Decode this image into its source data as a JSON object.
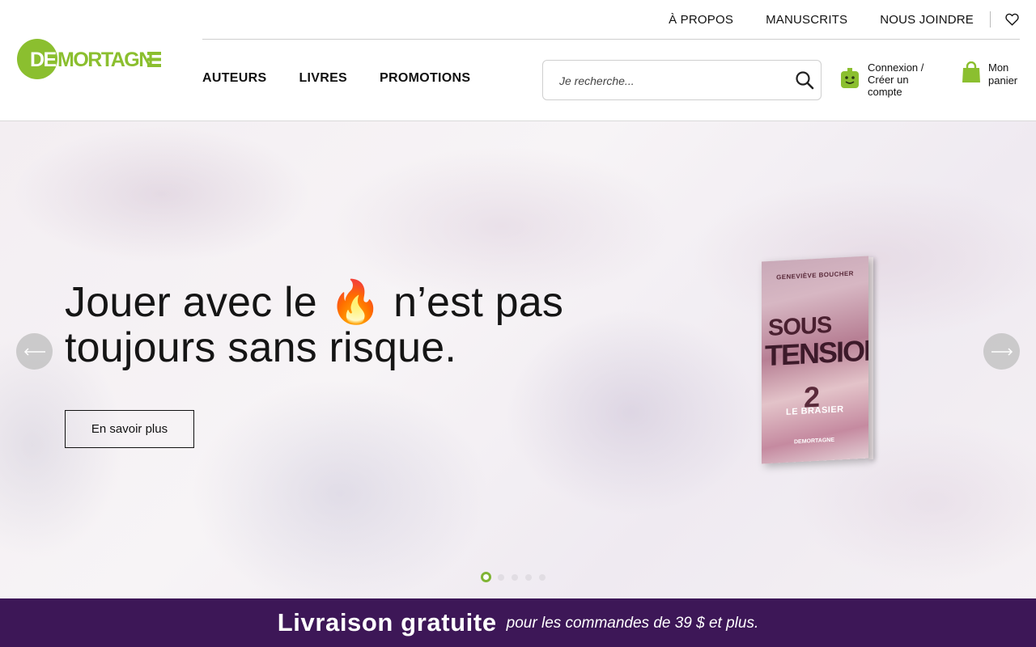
{
  "brand": {
    "name": "DEMORTAGNE",
    "accent": "#8bbf2f",
    "banner_color": "#3d1757"
  },
  "topnav": {
    "about": "À PROPOS",
    "manuscripts": "MANUSCRITS",
    "contact": "NOUS JOINDRE"
  },
  "mainnav": {
    "authors": "AUTEURS",
    "books": "LIVRES",
    "promotions": "PROMOTIONS"
  },
  "search": {
    "placeholder": "Je recherche..."
  },
  "account": {
    "line1": "Connexion /",
    "line2": "Créer un",
    "line3": "compte"
  },
  "cart": {
    "line1": "Mon",
    "line2": "panier"
  },
  "hero": {
    "headline_part1": "Jouer avec le",
    "emoji": "🔥",
    "headline_part2": "n’est pas toujours sans risque.",
    "cta": "En savoir plus",
    "slides_total": 5,
    "active_slide": 1
  },
  "book": {
    "author": "GENEVIÈVE BOUCHER",
    "title_line1": "SOUS",
    "title_line2": "TENSION",
    "volume": "2",
    "subtitle": "LE BRASIER",
    "publisher": "DEMORTAGNE"
  },
  "banner": {
    "main": "Livraison gratuite",
    "sub": "pour les commandes de 39 $ et plus."
  }
}
